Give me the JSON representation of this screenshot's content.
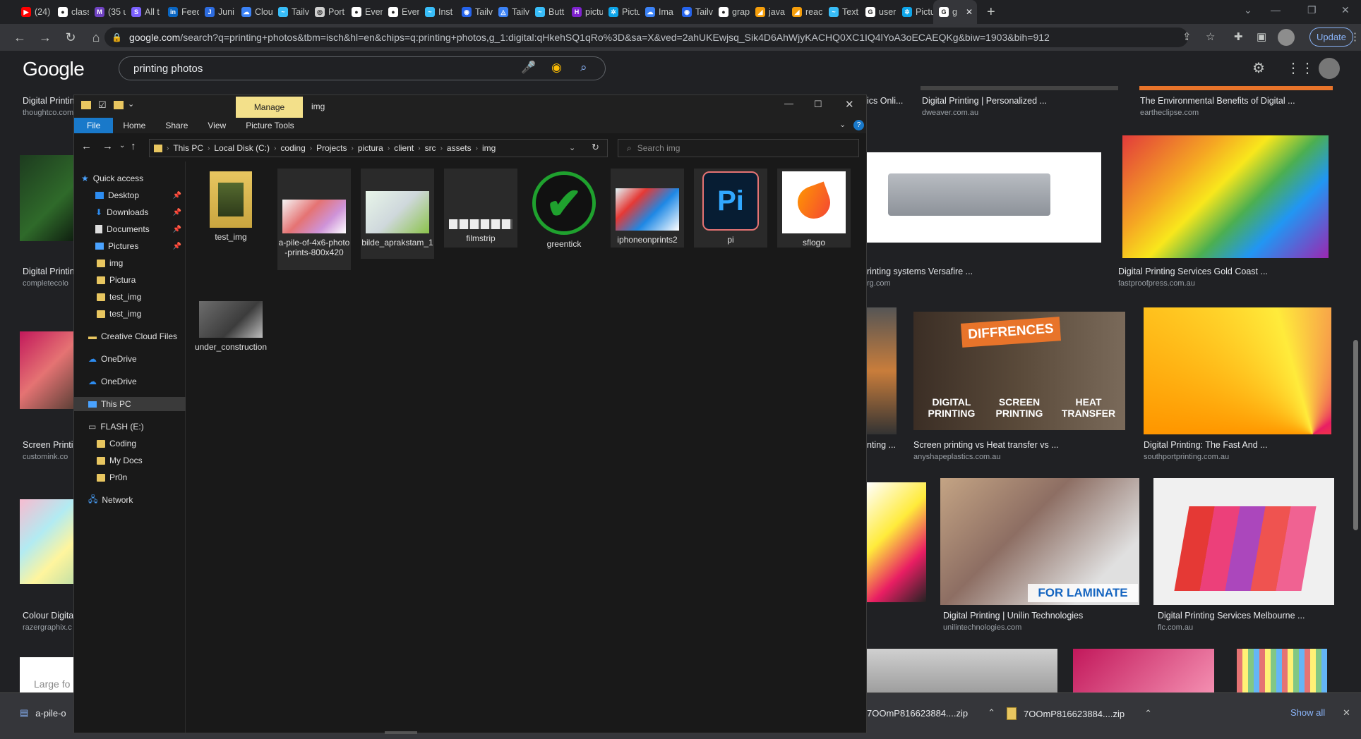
{
  "browser": {
    "tabs": [
      {
        "label": "(24)",
        "fav_color": "#ff0000",
        "fav_glyph": "▶"
      },
      {
        "label": "class",
        "fav_color": "#ffffff",
        "fav_glyph": "●"
      },
      {
        "label": "(35 u",
        "fav_color": "#6f42c1",
        "fav_glyph": "M"
      },
      {
        "label": "All t",
        "fav_color": "#7b61ff",
        "fav_glyph": "S"
      },
      {
        "label": "Feed",
        "fav_color": "#0a66c2",
        "fav_glyph": "in"
      },
      {
        "label": "Juni",
        "fav_color": "#2d6cdf",
        "fav_glyph": "J"
      },
      {
        "label": "Clou",
        "fav_color": "#3b82f6",
        "fav_glyph": "☁"
      },
      {
        "label": "Tailv",
        "fav_color": "#38bdf8",
        "fav_glyph": "~"
      },
      {
        "label": "Port",
        "fav_color": "#cfcfcf",
        "fav_glyph": "◎"
      },
      {
        "label": "Ever",
        "fav_color": "#ffffff",
        "fav_glyph": "●"
      },
      {
        "label": "Ever",
        "fav_color": "#ffffff",
        "fav_glyph": "●"
      },
      {
        "label": "Inst",
        "fav_color": "#38bdf8",
        "fav_glyph": "~"
      },
      {
        "label": "Tailv",
        "fav_color": "#2563eb",
        "fav_glyph": "◉"
      },
      {
        "label": "Tailv",
        "fav_color": "#3b82f6",
        "fav_glyph": "◬"
      },
      {
        "label": "Butt",
        "fav_color": "#38bdf8",
        "fav_glyph": "~"
      },
      {
        "label": "pictu",
        "fav_color": "#7e22ce",
        "fav_glyph": "H"
      },
      {
        "label": "Pictu",
        "fav_color": "#0ea5e9",
        "fav_glyph": "✲"
      },
      {
        "label": "Ima",
        "fav_color": "#3b82f6",
        "fav_glyph": "☁"
      },
      {
        "label": "Tailv",
        "fav_color": "#2563eb",
        "fav_glyph": "◉"
      },
      {
        "label": "grap",
        "fav_color": "#ffffff",
        "fav_glyph": "●"
      },
      {
        "label": "java",
        "fav_color": "#f59e0b",
        "fav_glyph": "◢"
      },
      {
        "label": "reac",
        "fav_color": "#f59e0b",
        "fav_glyph": "◢"
      },
      {
        "label": "Text",
        "fav_color": "#38bdf8",
        "fav_glyph": "~"
      },
      {
        "label": "user",
        "fav_color": "#ffffff",
        "fav_glyph": "G"
      },
      {
        "label": "Pictu",
        "fav_color": "#0ea5e9",
        "fav_glyph": "✲"
      },
      {
        "label": "g",
        "fav_color": "#ffffff",
        "fav_glyph": "G",
        "active": true
      }
    ],
    "url_host": "google.com",
    "url_rest": "/search?q=printing+photos&tbm=isch&hl=en&chips=q:printing+photos,g_1:digital:qHkehSQ1qRo%3D&sa=X&ved=2ahUKEwjsq_Sik4D6AhWjyKACHQ0XC1IQ4lYoA3oECAEQKg&biw=1903&bih=912",
    "update_label": "Update"
  },
  "google": {
    "logo": "Google",
    "query": "printing photos",
    "results": [
      {
        "title": "Digital Printing",
        "source": "thoughtco.com"
      },
      {
        "title": "Digital Printing | Personalized ...",
        "source": "dweaver.com.au"
      },
      {
        "title": "The Environmental Benefits of Digital ...",
        "source": "eartheclipse.com"
      },
      {
        "title": "Digital Printin",
        "source": "completecolo"
      },
      {
        "title": "rinting systems Versafire ...",
        "source": "rg.com"
      },
      {
        "title": "Digital Printing Services Gold Coast ...",
        "source": "fastproofpress.com.au"
      },
      {
        "title": "Screen Printin",
        "source": "customink.co"
      },
      {
        "title": "nting ...",
        "source": ""
      },
      {
        "title": "Screen printing vs Heat transfer vs ...",
        "source": "anyshapeplastics.com.au"
      },
      {
        "title": "Digital Printing: The Fast And ...",
        "source": "southportprinting.com.au"
      },
      {
        "title": "Colour Digita",
        "source": "razergraphix.c"
      },
      {
        "title": "Digital Printing | Unilin Technologies",
        "source": "unilintechnologies.com"
      },
      {
        "title": "Digital Printing Services Melbourne ...",
        "source": "flc.com.au"
      },
      {
        "title": "ics Onli...",
        "source": ""
      }
    ],
    "image_labels": {
      "diffrences": "DIFFRENCES",
      "digital": "DIGITAL PRINTING",
      "screen": "SCREEN PRINTING",
      "heat": "HEAT TRANSFER",
      "laminate": "FOR LAMINATE",
      "large_fo": "Large fo"
    }
  },
  "downloads": {
    "items": [
      "a-pile-o",
      "7OOmP816623884....zip",
      "7OOmP816623884....zip"
    ],
    "show_all": "Show all"
  },
  "explorer": {
    "title_manage": "Manage",
    "title_name": "img",
    "ribbon_tabs": [
      "File",
      "Home",
      "Share",
      "View",
      "Picture Tools"
    ],
    "breadcrumb": [
      "This PC",
      "Local Disk (C:)",
      "coding",
      "Projects",
      "pictura",
      "client",
      "src",
      "assets",
      "img"
    ],
    "search_placeholder": "Search img",
    "nav": {
      "quick_access": "Quick access",
      "desktop": "Desktop",
      "downloads": "Downloads",
      "documents": "Documents",
      "pictures": "Pictures",
      "img": "img",
      "pictura": "Pictura",
      "test_img_1": "test_img",
      "test_img_2": "test_img",
      "creative_cloud": "Creative Cloud Files",
      "onedrive_1": "OneDrive",
      "onedrive_2": "OneDrive",
      "this_pc": "This PC",
      "flash": "FLASH (E:)",
      "coding": "Coding",
      "my_docs": "My Docs",
      "pr0n": "Pr0n",
      "network": "Network"
    },
    "files": [
      {
        "name": "test_img"
      },
      {
        "name": "a-pile-of-4x6-photo-prints-800x420"
      },
      {
        "name": "bilde_aprakstam_1"
      },
      {
        "name": "filmstrip"
      },
      {
        "name": "greentick"
      },
      {
        "name": "iphoneonprints2"
      },
      {
        "name": "pi"
      },
      {
        "name": "sflogo"
      },
      {
        "name": "under_construction"
      }
    ],
    "pi_logo_text": "Pi"
  }
}
